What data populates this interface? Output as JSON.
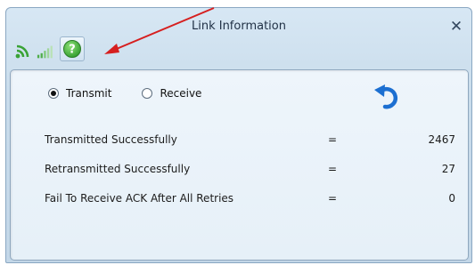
{
  "window": {
    "title": "Link Information",
    "close_glyph": "✕"
  },
  "toolbar": {
    "icons": [
      "wifi-signal-icon",
      "signal-bars-icon",
      "help-icon"
    ],
    "help_glyph": "?"
  },
  "mode": {
    "transmit_label": "Transmit",
    "receive_label": "Receive",
    "selected": "Transmit"
  },
  "stats": [
    {
      "label": "Transmitted Successfully",
      "eq": "=",
      "value": "2467"
    },
    {
      "label": "Retransmitted Successfully",
      "eq": "=",
      "value": "27"
    },
    {
      "label": "Fail To Receive ACK After All Retries",
      "eq": "=",
      "value": "0"
    }
  ],
  "colors": {
    "accent_green": "#3aa336",
    "arrow_red": "#d61f1f",
    "reset_blue": "#1c6fd1"
  }
}
